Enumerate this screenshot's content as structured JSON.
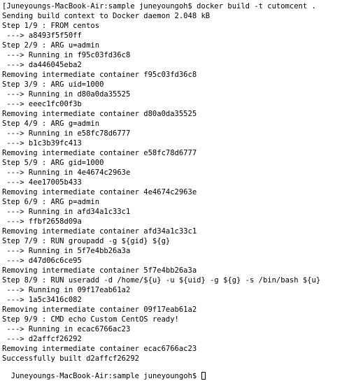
{
  "terminal": {
    "lines": [
      "[Juneyoungs-MacBook-Air:sample juneyoungoh$ docker build -t cutomcent .",
      "Sending build context to Docker daemon 2.048 kB",
      "Step 1/9 : FROM centos",
      " ---> a8493f5f50ff",
      "Step 2/9 : ARG u=admin",
      " ---> Running in f95c03fd36c8",
      " ---> da446045eba2",
      "Removing intermediate container f95c03fd36c8",
      "Step 3/9 : ARG uid=1000",
      " ---> Running in d80a0da35525",
      " ---> eeec1fc00f3b",
      "Removing intermediate container d80a0da35525",
      "Step 4/9 : ARG g=admin",
      " ---> Running in e58fc78d6777",
      " ---> b1c3b39fc413",
      "Removing intermediate container e58fc78d6777",
      "Step 5/9 : ARG gid=1000",
      " ---> Running in 4e4674c2963e",
      " ---> 4ee17005b433",
      "Removing intermediate container 4e4674c2963e",
      "Step 6/9 : ARG p=admin",
      " ---> Running in afd34a1c33c1",
      " ---> ffbf2658d09a",
      "Removing intermediate container afd34a1c33c1",
      "Step 7/9 : RUN groupadd -g ${gid} ${g}",
      " ---> Running in 5f7e4bb26a3a",
      " ---> d47d06c6ce95",
      "Removing intermediate container 5f7e4bb26a3a",
      "Step 8/9 : RUN useradd -d /home/${u} -u ${uid} -g ${g} -s /bin/bash ${u}",
      " ---> Running in 09f17eab61a2",
      " ---> 1a5c3416c082",
      "Removing intermediate container 09f17eab61a2",
      "Step 9/9 : CMD echo Custom CentOS ready!",
      " ---> Running in ecac6766ac23",
      " ---> d2affcf26292",
      "Removing intermediate container ecac6766ac23",
      "Successfully built d2affcf26292"
    ],
    "prompt": "Juneyoungs-MacBook-Air:sample juneyoungoh$ "
  }
}
